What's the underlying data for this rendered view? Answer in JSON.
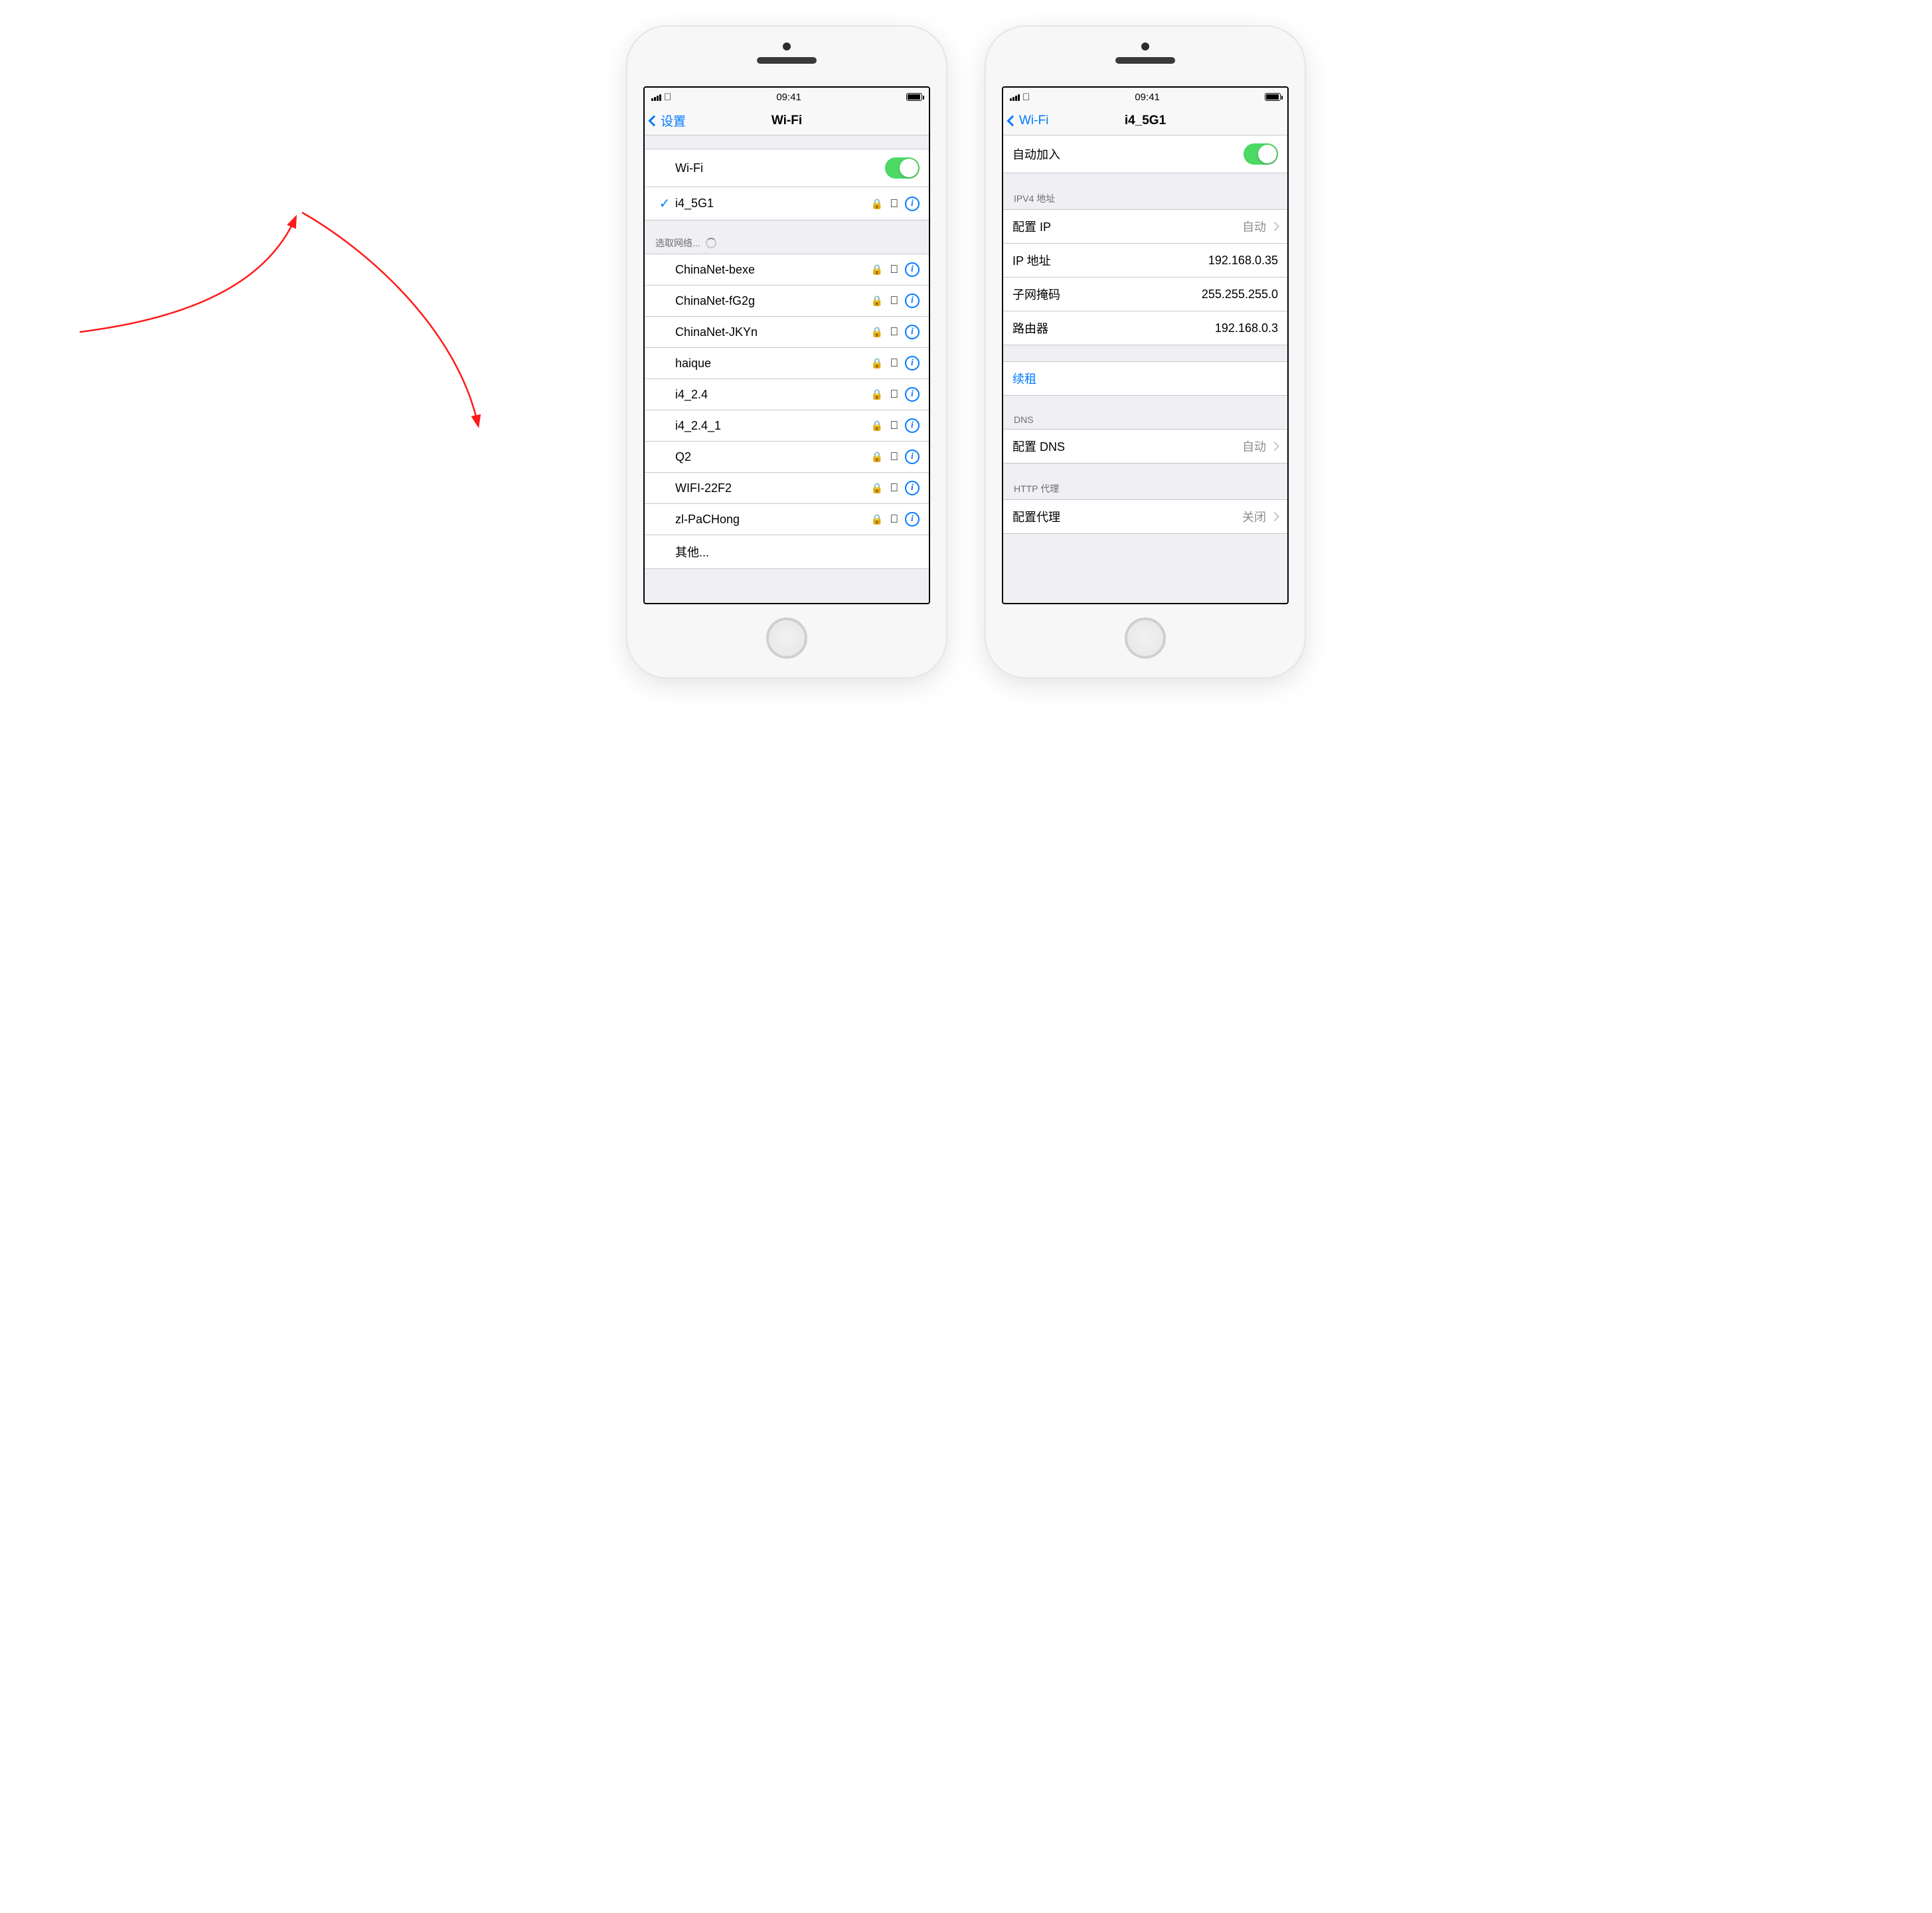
{
  "status": {
    "time": "09:41"
  },
  "left": {
    "nav": {
      "back": "设置",
      "title": "Wi-Fi"
    },
    "wifi_toggle_label": "Wi-Fi",
    "connected": {
      "ssid": "i4_5G1"
    },
    "choose_header": "选取网络...",
    "networks": [
      "ChinaNet-bexe",
      "ChinaNet-fG2g",
      "ChinaNet-JKYn",
      "haique",
      "i4_2.4",
      "i4_2.4_1",
      "Q2",
      "WIFI-22F2",
      "zl-PaCHong"
    ],
    "other": "其他..."
  },
  "right": {
    "nav": {
      "back": "Wi-Fi",
      "title": "i4_5G1"
    },
    "auto_join": "自动加入",
    "ipv4_header": "IPV4 地址",
    "config_ip_label": "配置 IP",
    "config_ip_value": "自动",
    "ip_label": "IP 地址",
    "ip_value": "192.168.0.35",
    "mask_label": "子网掩码",
    "mask_value": "255.255.255.0",
    "router_label": "路由器",
    "router_value": "192.168.0.3",
    "renew": "续租",
    "dns_header": "DNS",
    "config_dns_label": "配置 DNS",
    "config_dns_value": "自动",
    "proxy_header": "HTTP 代理",
    "config_proxy_label": "配置代理",
    "config_proxy_value": "关闭"
  }
}
